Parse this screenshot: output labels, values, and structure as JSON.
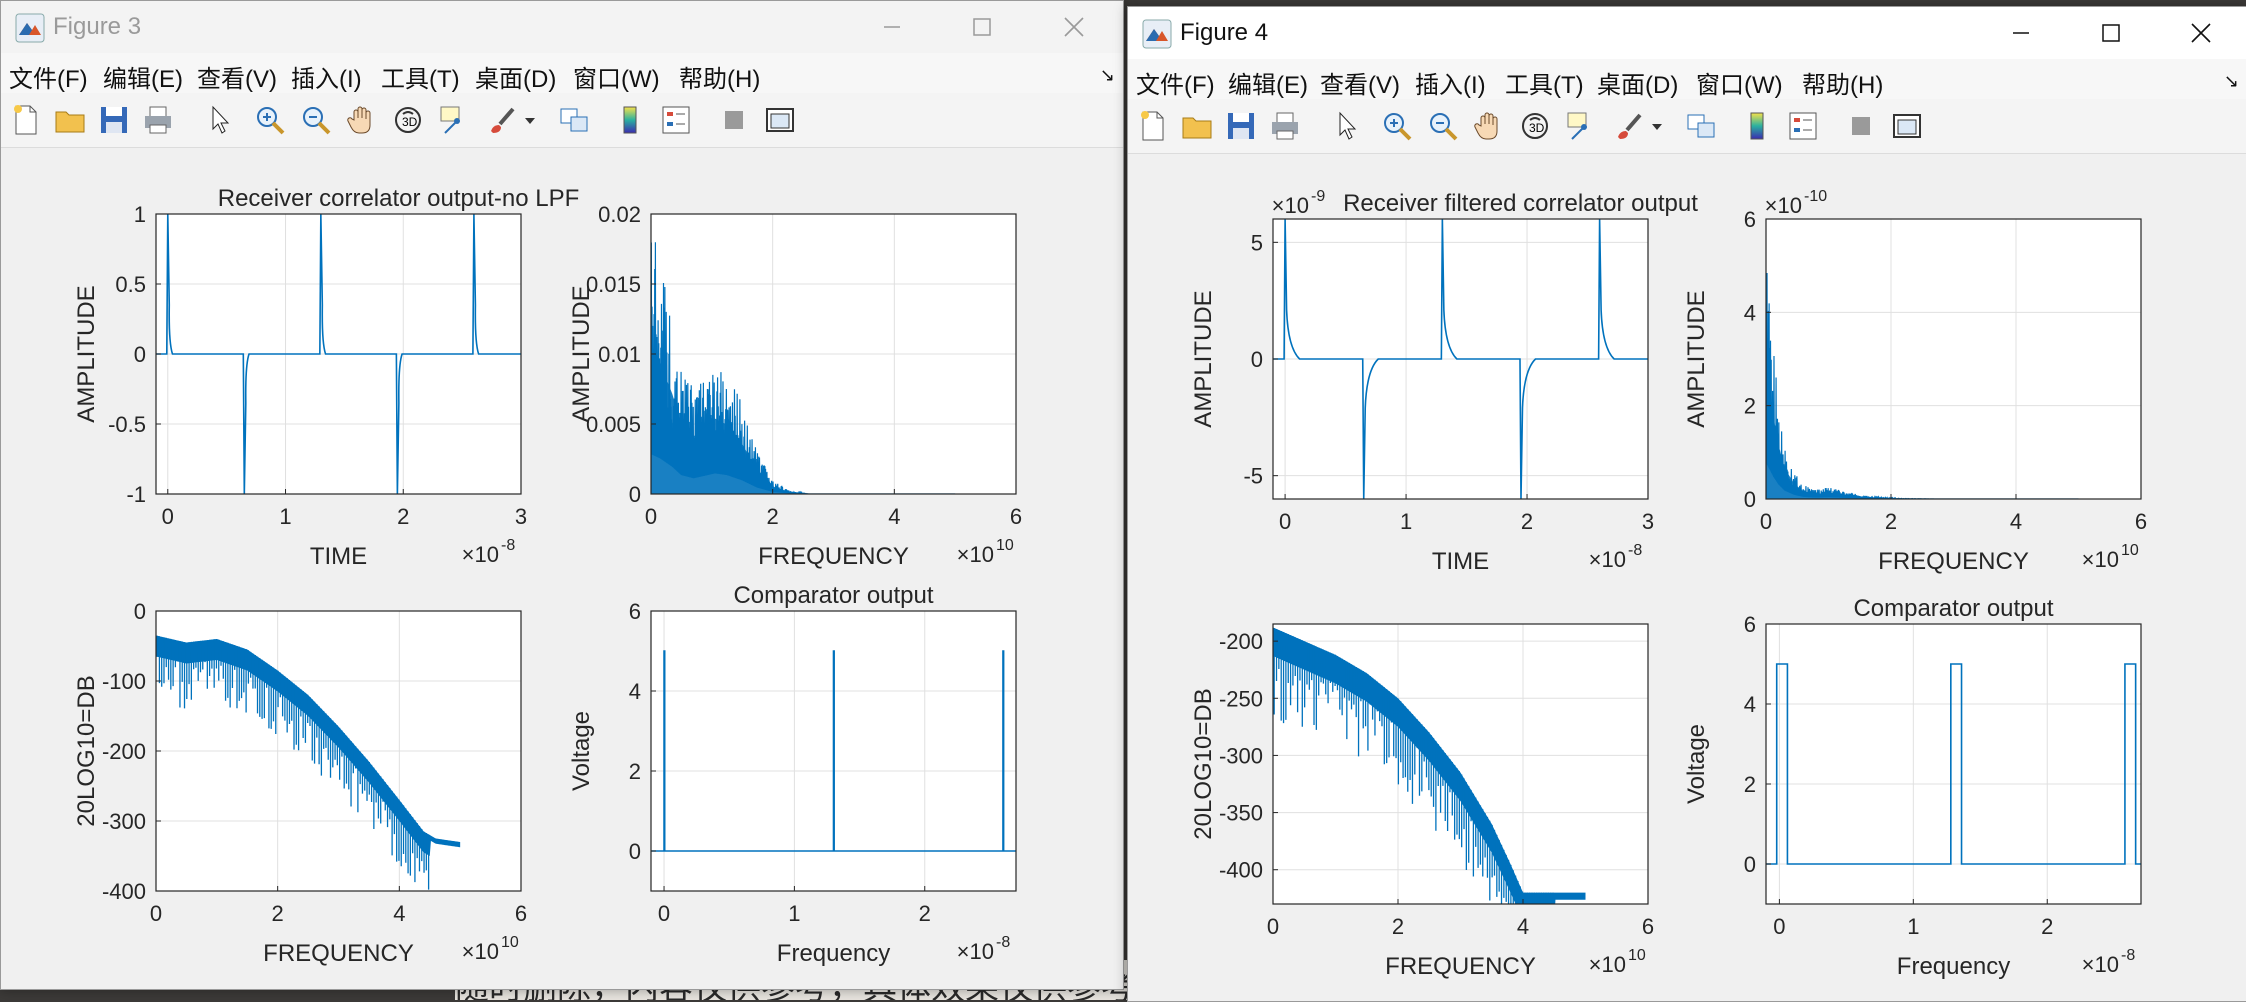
{
  "figures": [
    {
      "id": "fig3",
      "title": "Figure 3",
      "active": false,
      "menus": [
        "文件(F)",
        "编辑(E)",
        "查看(V)",
        "插入(I)",
        "工具(T)",
        "桌面(D)",
        "窗口(W)",
        "帮助(H)"
      ],
      "axes": [
        {
          "title": "Receiver correlator output-no LPF",
          "xlabel": "TIME",
          "ylabel": "AMPLITUDE",
          "xlim": [
            -0.1,
            3
          ],
          "ylim": [
            -1,
            1
          ],
          "xticks": [
            {
              "v": 0,
              "label": "0"
            },
            {
              "v": 1,
              "label": "1"
            },
            {
              "v": 2,
              "label": "2"
            },
            {
              "v": 3,
              "label": "3"
            }
          ],
          "yticks": [
            {
              "v": -1,
              "label": "-1"
            },
            {
              "v": -0.5,
              "label": "-0.5"
            },
            {
              "v": 0,
              "label": "0"
            },
            {
              "v": 0.5,
              "label": "0.5"
            },
            {
              "v": 1,
              "label": "1"
            }
          ],
          "xexp": "-8",
          "yexp": "",
          "kind": "pulse",
          "pulses": [
            {
              "x": 0,
              "y": 1
            },
            {
              "x": 0.65,
              "y": -1
            },
            {
              "x": 1.3,
              "y": 1
            },
            {
              "x": 1.95,
              "y": -1
            },
            {
              "x": 2.6,
              "y": 1
            }
          ],
          "decay": 0.02,
          "base": 0
        },
        {
          "title": "",
          "xlabel": "FREQUENCY",
          "ylabel": "AMPLITUDE",
          "xlim": [
            0,
            6
          ],
          "ylim": [
            0,
            0.02
          ],
          "xticks": [
            {
              "v": 0,
              "label": "0"
            },
            {
              "v": 2,
              "label": "2"
            },
            {
              "v": 4,
              "label": "4"
            },
            {
              "v": 6,
              "label": "6"
            }
          ],
          "yticks": [
            {
              "v": 0,
              "label": "0"
            },
            {
              "v": 0.005,
              "label": "0.005"
            },
            {
              "v": 0.01,
              "label": "0.01"
            },
            {
              "v": 0.015,
              "label": "0.015"
            },
            {
              "v": 0.02,
              "label": "0.02"
            }
          ],
          "xexp": "10",
          "yexp": "",
          "kind": "spectrum",
          "envelope": [
            [
              0,
              0.019
            ],
            [
              0.15,
              0.017
            ],
            [
              0.35,
              0.013
            ],
            [
              0.5,
              0.009
            ],
            [
              0.7,
              0.0075
            ],
            [
              0.9,
              0.0088
            ],
            [
              1.05,
              0.0098
            ],
            [
              1.25,
              0.009
            ],
            [
              1.5,
              0.0065
            ],
            [
              1.75,
              0.003
            ],
            [
              2.0,
              0.001
            ],
            [
              2.3,
              0.0002
            ],
            [
              2.6,
              0
            ],
            [
              5,
              0
            ]
          ],
          "fill": true
        },
        {
          "title": "",
          "xlabel": "FREQUENCY",
          "ylabel": "20LOG10=DB",
          "xlim": [
            0,
            6
          ],
          "ylim": [
            -400,
            0
          ],
          "xticks": [
            {
              "v": 0,
              "label": "0"
            },
            {
              "v": 2,
              "label": "2"
            },
            {
              "v": 4,
              "label": "4"
            },
            {
              "v": 6,
              "label": "6"
            }
          ],
          "yticks": [
            {
              "v": -400,
              "label": "-400"
            },
            {
              "v": -300,
              "label": "-300"
            },
            {
              "v": -200,
              "label": "-200"
            },
            {
              "v": -100,
              "label": "-100"
            },
            {
              "v": 0,
              "label": "0"
            }
          ],
          "xexp": "10",
          "yexp": "",
          "kind": "db",
          "top": [
            [
              0,
              -35
            ],
            [
              0.5,
              -45
            ],
            [
              1.0,
              -40
            ],
            [
              1.5,
              -55
            ],
            [
              2.0,
              -85
            ],
            [
              2.5,
              -120
            ],
            [
              3.0,
              -165
            ],
            [
              3.5,
              -215
            ],
            [
              4.0,
              -270
            ],
            [
              4.4,
              -315
            ],
            [
              4.6,
              -325
            ],
            [
              5.0,
              -330
            ]
          ],
          "band": 30
        },
        {
          "title": "Comparator output",
          "xlabel": "Frequency",
          "ylabel": "Voltage",
          "xlim": [
            -0.1,
            2.7
          ],
          "ylim": [
            -1,
            6
          ],
          "xticks": [
            {
              "v": 0,
              "label": "0"
            },
            {
              "v": 1,
              "label": "1"
            },
            {
              "v": 2,
              "label": "2"
            }
          ],
          "yticks": [
            {
              "v": 0,
              "label": "0"
            },
            {
              "v": 2,
              "label": "2"
            },
            {
              "v": 4,
              "label": "4"
            },
            {
              "v": 6,
              "label": "6"
            }
          ],
          "xexp": "-8",
          "yexp": "",
          "kind": "comparator",
          "pulses": [
            {
              "x": 0,
              "w": 0.005
            },
            {
              "x": 1.3,
              "w": 0.005
            },
            {
              "x": 2.6,
              "w": 0.005
            }
          ],
          "high": 5
        }
      ]
    },
    {
      "id": "fig4",
      "title": "Figure 4",
      "active": true,
      "menus": [
        "文件(F)",
        "编辑(E)",
        "查看(V)",
        "插入(I)",
        "工具(T)",
        "桌面(D)",
        "窗口(W)",
        "帮助(H)"
      ],
      "axes": [
        {
          "title": "Receiver filtered correlator output",
          "xlabel": "TIME",
          "ylabel": "AMPLITUDE",
          "xlim": [
            -0.1,
            3
          ],
          "ylim": [
            -6,
            6
          ],
          "xticks": [
            {
              "v": 0,
              "label": "0"
            },
            {
              "v": 1,
              "label": "1"
            },
            {
              "v": 2,
              "label": "2"
            },
            {
              "v": 3,
              "label": "3"
            }
          ],
          "yticks": [
            {
              "v": -5,
              "label": "-5"
            },
            {
              "v": 0,
              "label": "0"
            },
            {
              "v": 5,
              "label": "5"
            }
          ],
          "xexp": "-8",
          "yexp": "-9",
          "kind": "pulse",
          "pulses": [
            {
              "x": 0,
              "y": 6
            },
            {
              "x": 0.65,
              "y": -6
            },
            {
              "x": 1.3,
              "y": 6
            },
            {
              "x": 1.95,
              "y": -6
            },
            {
              "x": 2.6,
              "y": 6
            }
          ],
          "decay": 0.06,
          "base": 0
        },
        {
          "title": "",
          "xlabel": "FREQUENCY",
          "ylabel": "AMPLITUDE",
          "xlim": [
            0,
            6
          ],
          "ylim": [
            0,
            6
          ],
          "xticks": [
            {
              "v": 0,
              "label": "0"
            },
            {
              "v": 2,
              "label": "2"
            },
            {
              "v": 4,
              "label": "4"
            },
            {
              "v": 6,
              "label": "6"
            }
          ],
          "yticks": [
            {
              "v": 0,
              "label": "0"
            },
            {
              "v": 2,
              "label": "2"
            },
            {
              "v": 4,
              "label": "4"
            },
            {
              "v": 6,
              "label": "6"
            }
          ],
          "xexp": "10",
          "yexp": "-10",
          "kind": "spectrum",
          "envelope": [
            [
              0,
              5.2
            ],
            [
              0.05,
              4.4
            ],
            [
              0.12,
              3.2
            ],
            [
              0.2,
              2.1
            ],
            [
              0.3,
              1.2
            ],
            [
              0.45,
              0.6
            ],
            [
              0.6,
              0.3
            ],
            [
              0.8,
              0.2
            ],
            [
              1.0,
              0.25
            ],
            [
              1.3,
              0.15
            ],
            [
              1.7,
              0.04
            ],
            [
              2.2,
              0.01
            ],
            [
              2.8,
              0
            ],
            [
              5,
              0
            ]
          ],
          "fill": true
        },
        {
          "title": "",
          "xlabel": "FREQUENCY",
          "ylabel": "20LOG10=DB",
          "xlim": [
            0,
            6
          ],
          "ylim": [
            -430,
            -185
          ],
          "xticks": [
            {
              "v": 0,
              "label": "0"
            },
            {
              "v": 2,
              "label": "2"
            },
            {
              "v": 4,
              "label": "4"
            },
            {
              "v": 6,
              "label": "6"
            }
          ],
          "yticks": [
            {
              "v": -400,
              "label": "-400"
            },
            {
              "v": -350,
              "label": "-350"
            },
            {
              "v": -300,
              "label": "-300"
            },
            {
              "v": -250,
              "label": "-250"
            },
            {
              "v": -200,
              "label": "-200"
            }
          ],
          "xexp": "10",
          "yexp": "",
          "kind": "db",
          "top": [
            [
              0,
              -188
            ],
            [
              0.5,
              -200
            ],
            [
              1.0,
              -212
            ],
            [
              1.5,
              -228
            ],
            [
              2.0,
              -250
            ],
            [
              2.5,
              -280
            ],
            [
              3.0,
              -315
            ],
            [
              3.5,
              -360
            ],
            [
              3.8,
              -395
            ],
            [
              4.0,
              -420
            ],
            [
              5.0,
              -420
            ]
          ],
          "band": 25
        },
        {
          "title": "Comparator output",
          "xlabel": "Frequency",
          "ylabel": "Voltage",
          "xlim": [
            -0.1,
            2.7
          ],
          "ylim": [
            -1,
            6
          ],
          "xticks": [
            {
              "v": 0,
              "label": "0"
            },
            {
              "v": 1,
              "label": "1"
            },
            {
              "v": 2,
              "label": "2"
            }
          ],
          "yticks": [
            {
              "v": 0,
              "label": "0"
            },
            {
              "v": 2,
              "label": "2"
            },
            {
              "v": 4,
              "label": "4"
            },
            {
              "v": 6,
              "label": "6"
            }
          ],
          "xexp": "-8",
          "yexp": "",
          "kind": "comparator",
          "pulses": [
            {
              "x": -0.02,
              "w": 0.08
            },
            {
              "x": 1.28,
              "w": 0.08
            },
            {
              "x": 2.58,
              "w": 0.08
            }
          ],
          "high": 5
        }
      ]
    }
  ],
  "background": {
    "text": "随时删除，内容仅供参考，具体效果仅供参考"
  },
  "colors": {
    "line": "#0072bd",
    "grid": "#e0e0e0",
    "axis": "#262626"
  }
}
